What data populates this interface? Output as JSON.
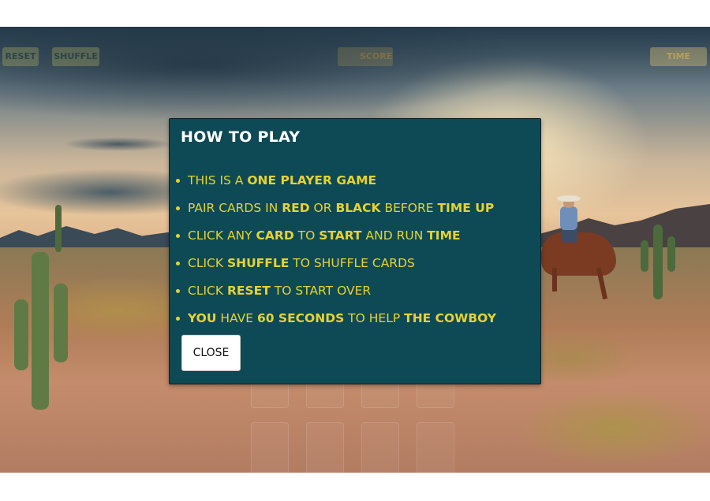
{
  "hud": {
    "reset_label": "RESET",
    "shuffle_label": "SHUFFLE",
    "score_label": "SCORE",
    "time_label": "TIME"
  },
  "modal": {
    "title": "HOW TO PLAY",
    "rules": [
      [
        {
          "t": "THIS IS A ",
          "b": false
        },
        {
          "t": "ONE PLAYER GAME",
          "b": true
        }
      ],
      [
        {
          "t": "PAIR CARDS IN ",
          "b": false
        },
        {
          "t": "RED",
          "b": true
        },
        {
          "t": " OR ",
          "b": false
        },
        {
          "t": "BLACK",
          "b": true
        },
        {
          "t": " BEFORE ",
          "b": false
        },
        {
          "t": "TIME UP",
          "b": true
        }
      ],
      [
        {
          "t": "CLICK ANY ",
          "b": false
        },
        {
          "t": "CARD",
          "b": true
        },
        {
          "t": " TO ",
          "b": false
        },
        {
          "t": "START",
          "b": true
        },
        {
          "t": " AND RUN ",
          "b": false
        },
        {
          "t": "TIME",
          "b": true
        }
      ],
      [
        {
          "t": "CLICK ",
          "b": false
        },
        {
          "t": "SHUFFLE",
          "b": true
        },
        {
          "t": " TO SHUFFLE CARDS",
          "b": false
        }
      ],
      [
        {
          "t": "CLICK ",
          "b": false
        },
        {
          "t": "RESET",
          "b": true
        },
        {
          "t": " TO START OVER",
          "b": false
        }
      ],
      [
        {
          "t": "YOU",
          "b": true
        },
        {
          "t": " HAVE ",
          "b": false
        },
        {
          "t": "60 SECONDS",
          "b": true
        },
        {
          "t": " TO HELP ",
          "b": false
        },
        {
          "t": "THE COWBOY",
          "b": true
        }
      ]
    ],
    "close_label": "CLOSE"
  },
  "colors": {
    "modal_bg": "#0e4a55",
    "rule_text": "#e6d233",
    "title_text": "#ffffff"
  }
}
